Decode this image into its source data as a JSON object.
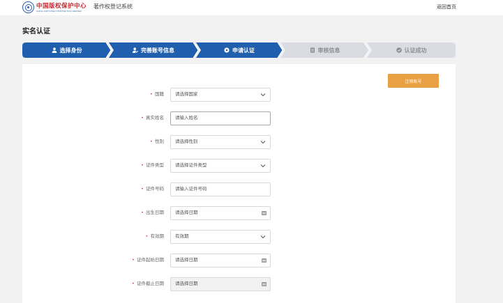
{
  "header": {
    "logo_cn": "中国版权保护中心",
    "logo_en": "CHINA COPYRIGHT PROTECTION CENTER",
    "system_name": "著作权登记系统",
    "back_home": "返回首页"
  },
  "page_title": "实名认证",
  "steps": [
    {
      "label": "选择身份",
      "icon": "user-icon",
      "state": "done"
    },
    {
      "label": "完善账号信息",
      "icon": "user-edit-icon",
      "state": "done"
    },
    {
      "label": "申请认证",
      "icon": "gear-icon",
      "state": "current"
    },
    {
      "label": "审核信息",
      "icon": "document-icon",
      "state": "pending"
    },
    {
      "label": "认证成功",
      "icon": "check-circle-icon",
      "state": "pending"
    }
  ],
  "cancel_button": "注销账号",
  "form": {
    "nationality": {
      "label": "国籍",
      "value": "请选择国家"
    },
    "real_name": {
      "label": "真实姓名",
      "placeholder": "请输入姓名"
    },
    "gender": {
      "label": "性别",
      "value": "请选择性别"
    },
    "id_type": {
      "label": "证件类型",
      "value": "请选择证件类型"
    },
    "id_number": {
      "label": "证件号码",
      "placeholder": "请输入证件号码"
    },
    "birth_date": {
      "label": "出生日期",
      "placeholder": "请选择日期"
    },
    "validity": {
      "label": "有效期",
      "value": "有效期"
    },
    "id_start_date": {
      "label": "证件起始日期",
      "placeholder": "请选择日期"
    },
    "id_end_date": {
      "label": "证件截止日期",
      "placeholder": "请选择日期"
    }
  },
  "colors": {
    "step_active": "#1f5fae",
    "step_inactive": "#d9dde2",
    "cancel_button": "#e9a044",
    "required_mark": "#d9363e"
  }
}
